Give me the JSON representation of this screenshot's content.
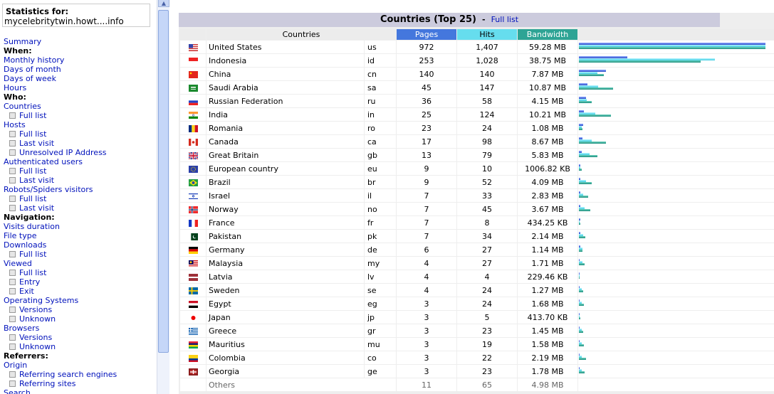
{
  "sidebar": {
    "stats_title": "Statistics for:",
    "site": "mycelebritytwin.howt....info",
    "items": [
      {
        "label": "Summary",
        "kind": "link"
      },
      {
        "label": "When:",
        "kind": "head"
      },
      {
        "label": "Monthly history",
        "kind": "link"
      },
      {
        "label": "Days of month",
        "kind": "link"
      },
      {
        "label": "Days of week",
        "kind": "link"
      },
      {
        "label": "Hours",
        "kind": "link"
      },
      {
        "label": "Who:",
        "kind": "head"
      },
      {
        "label": "Countries",
        "kind": "link"
      },
      {
        "label": "Full list",
        "kind": "sub"
      },
      {
        "label": "Hosts",
        "kind": "link"
      },
      {
        "label": "Full list",
        "kind": "sub"
      },
      {
        "label": "Last visit",
        "kind": "sub"
      },
      {
        "label": "Unresolved IP Address",
        "kind": "sub"
      },
      {
        "label": "Authenticated users",
        "kind": "link"
      },
      {
        "label": "Full list",
        "kind": "sub"
      },
      {
        "label": "Last visit",
        "kind": "sub"
      },
      {
        "label": "Robots/Spiders visitors",
        "kind": "link"
      },
      {
        "label": "Full list",
        "kind": "sub"
      },
      {
        "label": "Last visit",
        "kind": "sub"
      },
      {
        "label": "Navigation:",
        "kind": "head"
      },
      {
        "label": "Visits duration",
        "kind": "link"
      },
      {
        "label": "File type",
        "kind": "link"
      },
      {
        "label": "Downloads",
        "kind": "link"
      },
      {
        "label": "Full list",
        "kind": "sub"
      },
      {
        "label": "Viewed",
        "kind": "link"
      },
      {
        "label": "Full list",
        "kind": "sub"
      },
      {
        "label": "Entry",
        "kind": "sub"
      },
      {
        "label": "Exit",
        "kind": "sub"
      },
      {
        "label": "Operating Systems",
        "kind": "link"
      },
      {
        "label": "Versions",
        "kind": "sub"
      },
      {
        "label": "Unknown",
        "kind": "sub"
      },
      {
        "label": "Browsers",
        "kind": "link"
      },
      {
        "label": "Versions",
        "kind": "sub"
      },
      {
        "label": "Unknown",
        "kind": "sub"
      },
      {
        "label": "Referrers:",
        "kind": "head"
      },
      {
        "label": "Origin",
        "kind": "link"
      },
      {
        "label": "Referring search engines",
        "kind": "sub"
      },
      {
        "label": "Referring sites",
        "kind": "sub"
      },
      {
        "label": "Search",
        "kind": "link"
      }
    ]
  },
  "main": {
    "title": "Countries (Top 25)",
    "separator": "-",
    "full_list_link": "Full list",
    "headers": {
      "countries": "Countries",
      "pages": "Pages",
      "hits": "Hits",
      "bandwidth": "Bandwidth"
    },
    "bar_colors": {
      "pages": "#4477dd",
      "hits": "#66ddee",
      "bandwidth": "#2ea495"
    },
    "rows": [
      {
        "name": "United States",
        "code": "us",
        "pages": "972",
        "hits": "1,407",
        "bandwidth": "59.28 MB",
        "pv": 972,
        "hv": 1407,
        "bv": 59.28,
        "flag": "us"
      },
      {
        "name": "Indonesia",
        "code": "id",
        "pages": "253",
        "hits": "1,028",
        "bandwidth": "38.75 MB",
        "pv": 253,
        "hv": 1028,
        "bv": 38.75,
        "flag": "id"
      },
      {
        "name": "China",
        "code": "cn",
        "pages": "140",
        "hits": "140",
        "bandwidth": "7.87 MB",
        "pv": 140,
        "hv": 140,
        "bv": 7.87,
        "flag": "cn"
      },
      {
        "name": "Saudi Arabia",
        "code": "sa",
        "pages": "45",
        "hits": "147",
        "bandwidth": "10.87 MB",
        "pv": 45,
        "hv": 147,
        "bv": 10.87,
        "flag": "sa"
      },
      {
        "name": "Russian Federation",
        "code": "ru",
        "pages": "36",
        "hits": "58",
        "bandwidth": "4.15 MB",
        "pv": 36,
        "hv": 58,
        "bv": 4.15,
        "flag": "ru"
      },
      {
        "name": "India",
        "code": "in",
        "pages": "25",
        "hits": "124",
        "bandwidth": "10.21 MB",
        "pv": 25,
        "hv": 124,
        "bv": 10.21,
        "flag": "in"
      },
      {
        "name": "Romania",
        "code": "ro",
        "pages": "23",
        "hits": "24",
        "bandwidth": "1.08 MB",
        "pv": 23,
        "hv": 24,
        "bv": 1.08,
        "flag": "ro"
      },
      {
        "name": "Canada",
        "code": "ca",
        "pages": "17",
        "hits": "98",
        "bandwidth": "8.67 MB",
        "pv": 17,
        "hv": 98,
        "bv": 8.67,
        "flag": "ca"
      },
      {
        "name": "Great Britain",
        "code": "gb",
        "pages": "13",
        "hits": "79",
        "bandwidth": "5.83 MB",
        "pv": 13,
        "hv": 79,
        "bv": 5.83,
        "flag": "gb"
      },
      {
        "name": "European country",
        "code": "eu",
        "pages": "9",
        "hits": "10",
        "bandwidth": "1006.82 KB",
        "pv": 9,
        "hv": 10,
        "bv": 0.98,
        "flag": "eu"
      },
      {
        "name": "Brazil",
        "code": "br",
        "pages": "9",
        "hits": "52",
        "bandwidth": "4.09 MB",
        "pv": 9,
        "hv": 52,
        "bv": 4.09,
        "flag": "br"
      },
      {
        "name": "Israel",
        "code": "il",
        "pages": "7",
        "hits": "33",
        "bandwidth": "2.83 MB",
        "pv": 7,
        "hv": 33,
        "bv": 2.83,
        "flag": "il"
      },
      {
        "name": "Norway",
        "code": "no",
        "pages": "7",
        "hits": "45",
        "bandwidth": "3.67 MB",
        "pv": 7,
        "hv": 45,
        "bv": 3.67,
        "flag": "no"
      },
      {
        "name": "France",
        "code": "fr",
        "pages": "7",
        "hits": "8",
        "bandwidth": "434.25 KB",
        "pv": 7,
        "hv": 8,
        "bv": 0.42,
        "flag": "fr"
      },
      {
        "name": "Pakistan",
        "code": "pk",
        "pages": "7",
        "hits": "34",
        "bandwidth": "2.14 MB",
        "pv": 7,
        "hv": 34,
        "bv": 2.14,
        "flag": "pk"
      },
      {
        "name": "Germany",
        "code": "de",
        "pages": "6",
        "hits": "27",
        "bandwidth": "1.14 MB",
        "pv": 6,
        "hv": 27,
        "bv": 1.14,
        "flag": "de"
      },
      {
        "name": "Malaysia",
        "code": "my",
        "pages": "4",
        "hits": "27",
        "bandwidth": "1.71 MB",
        "pv": 4,
        "hv": 27,
        "bv": 1.71,
        "flag": "my"
      },
      {
        "name": "Latvia",
        "code": "lv",
        "pages": "4",
        "hits": "4",
        "bandwidth": "229.46 KB",
        "pv": 4,
        "hv": 4,
        "bv": 0.22,
        "flag": "lv"
      },
      {
        "name": "Sweden",
        "code": "se",
        "pages": "4",
        "hits": "24",
        "bandwidth": "1.27 MB",
        "pv": 4,
        "hv": 24,
        "bv": 1.27,
        "flag": "se"
      },
      {
        "name": "Egypt",
        "code": "eg",
        "pages": "3",
        "hits": "24",
        "bandwidth": "1.68 MB",
        "pv": 3,
        "hv": 24,
        "bv": 1.68,
        "flag": "eg"
      },
      {
        "name": "Japan",
        "code": "jp",
        "pages": "3",
        "hits": "5",
        "bandwidth": "413.70 KB",
        "pv": 3,
        "hv": 5,
        "bv": 0.4,
        "flag": "jp"
      },
      {
        "name": "Greece",
        "code": "gr",
        "pages": "3",
        "hits": "23",
        "bandwidth": "1.45 MB",
        "pv": 3,
        "hv": 23,
        "bv": 1.45,
        "flag": "gr"
      },
      {
        "name": "Mauritius",
        "code": "mu",
        "pages": "3",
        "hits": "19",
        "bandwidth": "1.58 MB",
        "pv": 3,
        "hv": 19,
        "bv": 1.58,
        "flag": "mu"
      },
      {
        "name": "Colombia",
        "code": "co",
        "pages": "3",
        "hits": "22",
        "bandwidth": "2.19 MB",
        "pv": 3,
        "hv": 22,
        "bv": 2.19,
        "flag": "co"
      },
      {
        "name": "Georgia",
        "code": "ge",
        "pages": "3",
        "hits": "23",
        "bandwidth": "1.78 MB",
        "pv": 3,
        "hv": 23,
        "bv": 1.78,
        "flag": "ge"
      }
    ],
    "others": {
      "label": "Others",
      "pages": "11",
      "hits": "65",
      "bandwidth": "4.98 MB"
    }
  }
}
